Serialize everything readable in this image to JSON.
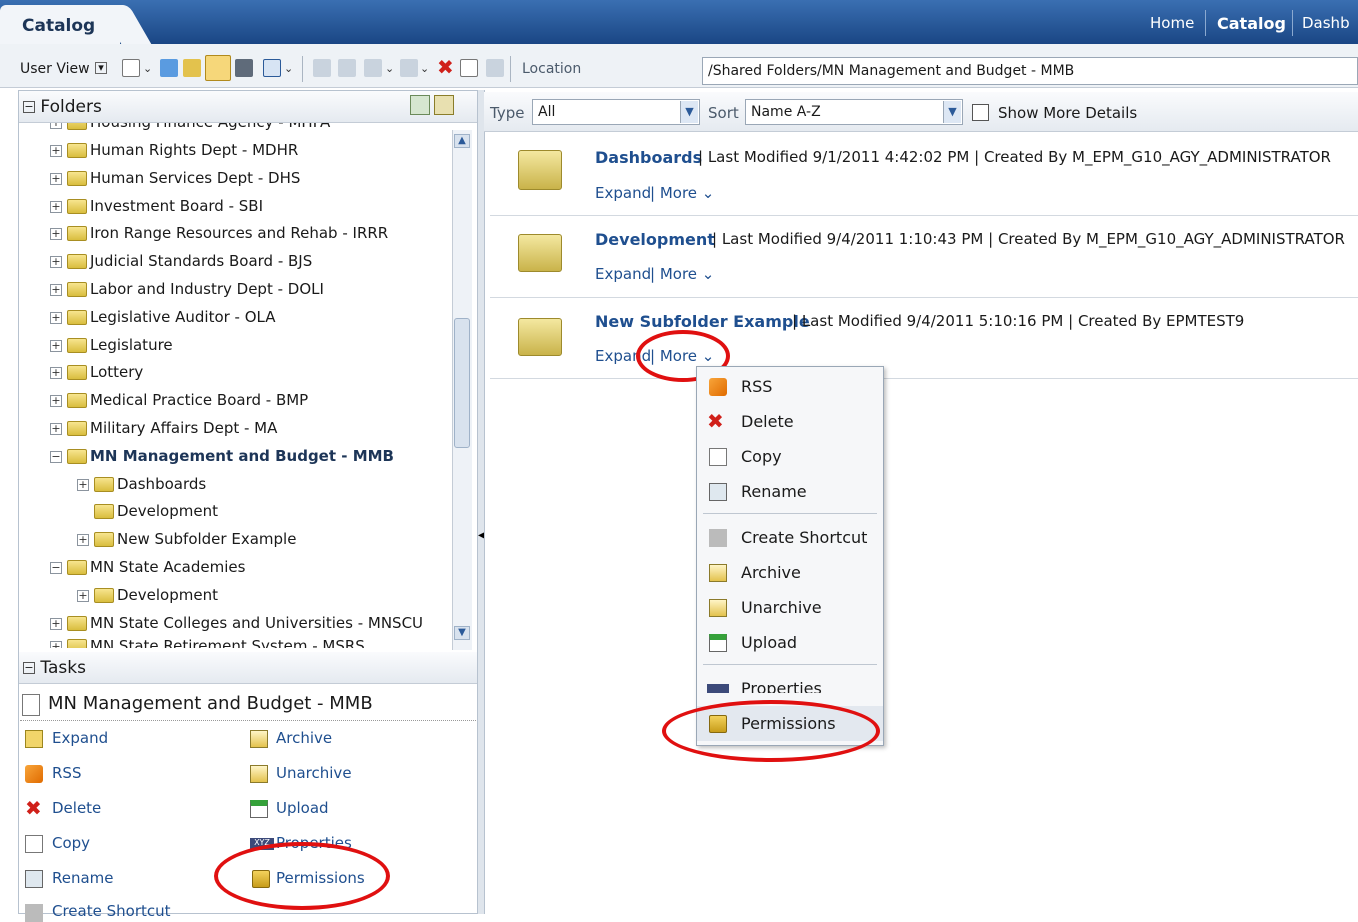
{
  "header": {
    "active_tab": "Catalog",
    "links": [
      "Home",
      "Catalog",
      "Dashb"
    ]
  },
  "toolbar": {
    "user_view_label": "User View",
    "location_label": "Location",
    "location_value": "/Shared Folders/MN Management and Budget - MMB"
  },
  "folders": {
    "title": "Folders",
    "cut_top": "Housing Finance Agency - MHFA",
    "items": [
      "Human Rights Dept - MDHR",
      "Human Services Dept - DHS",
      "Investment Board - SBI",
      "Iron Range Resources and Rehab - IRRR",
      "Judicial Standards Board - BJS",
      "Labor and Industry Dept - DOLI",
      "Legislative Auditor - OLA",
      "Legislature",
      "Lottery",
      "Medical Practice Board - BMP",
      "Military Affairs Dept - MA",
      "MN Management and Budget - MMB",
      "Dashboards",
      "Development",
      "New Subfolder Example",
      "MN State Academies",
      "Development",
      "MN State Colleges and Universities - MNSCU"
    ],
    "cut_bottom": "MN State Retirement System - MSRS"
  },
  "tasks": {
    "title": "Tasks",
    "selected": "MN Management and Budget - MMB",
    "left_col": [
      "Expand",
      "RSS",
      "Delete",
      "Copy",
      "Rename",
      "Create Shortcut"
    ],
    "right_col": [
      "Archive",
      "Unarchive",
      "Upload",
      "Properties",
      "Permissions"
    ]
  },
  "filter": {
    "type_label": "Type",
    "type_value": "All",
    "sort_label": "Sort",
    "sort_value": "Name A-Z",
    "details_label": "Show More Details"
  },
  "items": [
    {
      "title": "Dashboards",
      "modified": "Last Modified 9/1/2011 4:42:02 PM",
      "created": "Created By M_EPM_G10_AGY_ADMINISTRATOR",
      "expand": "Expand",
      "more": "More"
    },
    {
      "title": "Development",
      "modified": "Last Modified 9/4/2011 1:10:43 PM",
      "created": "Created By M_EPM_G10_AGY_ADMINISTRATOR",
      "expand": "Expand",
      "more": "More"
    },
    {
      "title": "New Subfolder Example",
      "modified": "Last Modified 9/4/2011 5:10:16 PM",
      "created": "Created By EPMTEST9",
      "expand": "Expand",
      "more": "More"
    }
  ],
  "menu": [
    "RSS",
    "Delete",
    "Copy",
    "Rename",
    "Create Shortcut",
    "Archive",
    "Unarchive",
    "Upload",
    "Properties",
    "Permissions"
  ],
  "colors": {
    "accent": "#1f4f8f",
    "highlight": "#e01010"
  }
}
